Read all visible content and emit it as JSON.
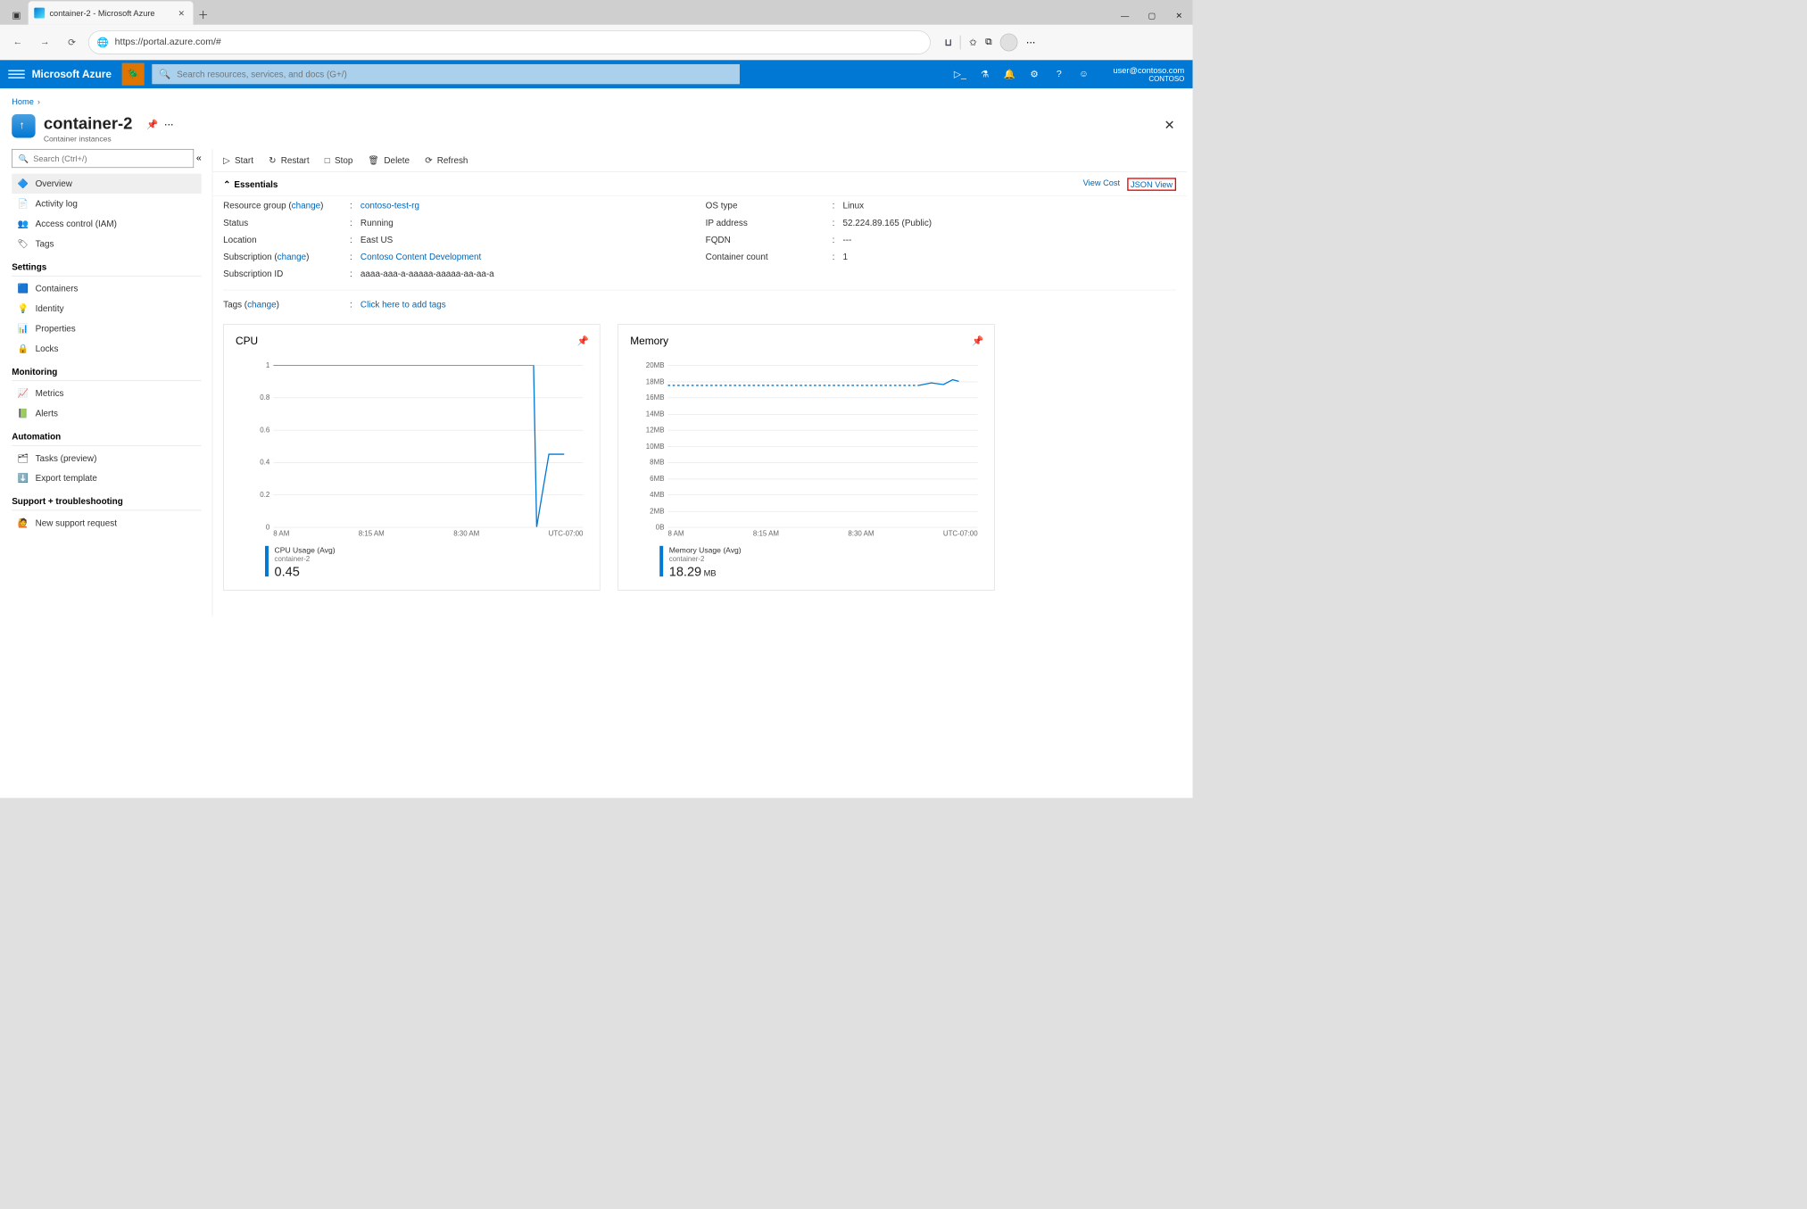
{
  "browser": {
    "tab_title": "container-2 - Microsoft Azure",
    "url": "https://portal.azure.com/#"
  },
  "azure_header": {
    "brand": "Microsoft Azure",
    "search_placeholder": "Search resources, services, and docs (G+/)",
    "user_email": "user@contoso.com",
    "tenant": "CONTOSO"
  },
  "breadcrumb": {
    "home": "Home"
  },
  "resource": {
    "name": "container-2",
    "type": "Container instances"
  },
  "sidebar": {
    "search_placeholder": "Search (Ctrl+/)",
    "groups": [
      {
        "items": [
          {
            "label": "Overview",
            "icon": "🔷",
            "active": true
          },
          {
            "label": "Activity log",
            "icon": "📄"
          },
          {
            "label": "Access control (IAM)",
            "icon": "👥"
          },
          {
            "label": "Tags",
            "icon": "🏷"
          }
        ]
      },
      {
        "head": "Settings",
        "items": [
          {
            "label": "Containers",
            "icon": "🟦"
          },
          {
            "label": "Identity",
            "icon": "💡"
          },
          {
            "label": "Properties",
            "icon": "📊"
          },
          {
            "label": "Locks",
            "icon": "🔒"
          }
        ]
      },
      {
        "head": "Monitoring",
        "items": [
          {
            "label": "Metrics",
            "icon": "📈"
          },
          {
            "label": "Alerts",
            "icon": "📗"
          }
        ]
      },
      {
        "head": "Automation",
        "items": [
          {
            "label": "Tasks (preview)",
            "icon": "🗂"
          },
          {
            "label": "Export template",
            "icon": "⬇️"
          }
        ]
      },
      {
        "head": "Support + troubleshooting",
        "items": [
          {
            "label": "New support request",
            "icon": "🙋"
          }
        ]
      }
    ]
  },
  "toolbar": {
    "start": "Start",
    "restart": "Restart",
    "stop": "Stop",
    "delete": "Delete",
    "refresh": "Refresh"
  },
  "essentials": {
    "title": "Essentials",
    "view_cost": "View Cost",
    "json_view": "JSON View",
    "left": [
      {
        "label": "Resource group",
        "change": "change",
        "value": "contoso-test-rg",
        "link": true
      },
      {
        "label": "Status",
        "value": "Running"
      },
      {
        "label": "Location",
        "value": "East US"
      },
      {
        "label": "Subscription",
        "change": "change",
        "value": "Contoso Content Development",
        "link": true
      },
      {
        "label": "Subscription ID",
        "value": "aaaa-aaa-a-aaaaa-aaaaa-aa-aa-a"
      }
    ],
    "right": [
      {
        "label": "OS type",
        "value": "Linux"
      },
      {
        "label": "IP address",
        "value": "52.224.89.165 (Public)"
      },
      {
        "label": "FQDN",
        "value": "---"
      },
      {
        "label": "Container count",
        "value": "1"
      }
    ],
    "tags": {
      "label": "Tags",
      "change": "change",
      "value": "Click here to add tags"
    }
  },
  "chart_data": [
    {
      "type": "line",
      "title": "CPU",
      "ylabel": "",
      "xlabel": "",
      "y_ticks": [
        0,
        0.2,
        0.4,
        0.6,
        0.8,
        1
      ],
      "ylim": [
        0,
        1
      ],
      "x_ticks": [
        "8 AM",
        "8:15 AM",
        "8:30 AM",
        "UTC-07:00"
      ],
      "series": [
        {
          "name": "CPU Usage (Avg)",
          "sub": "container-2",
          "value_label": "0.45",
          "unit": "",
          "points": [
            [
              0,
              1
            ],
            [
              0.85,
              1
            ],
            [
              0.86,
              0
            ],
            [
              0.9,
              0.45
            ],
            [
              0.95,
              0.45
            ]
          ]
        }
      ]
    },
    {
      "type": "line",
      "title": "Memory",
      "y_ticks": [
        "0B",
        "2MB",
        "4MB",
        "6MB",
        "8MB",
        "10MB",
        "12MB",
        "14MB",
        "16MB",
        "18MB",
        "20MB"
      ],
      "ylim": [
        0,
        20
      ],
      "x_ticks": [
        "8 AM",
        "8:15 AM",
        "8:30 AM",
        "UTC-07:00"
      ],
      "series": [
        {
          "name": "Memory Usage (Avg)",
          "sub": "container-2",
          "value_label": "18.29",
          "unit": "MB",
          "points": [
            [
              0,
              17.5
            ],
            [
              0.82,
              17.5
            ],
            [
              0.86,
              17.8
            ],
            [
              0.9,
              17.6
            ],
            [
              0.93,
              18.2
            ],
            [
              0.95,
              18.0
            ]
          ]
        }
      ]
    }
  ]
}
